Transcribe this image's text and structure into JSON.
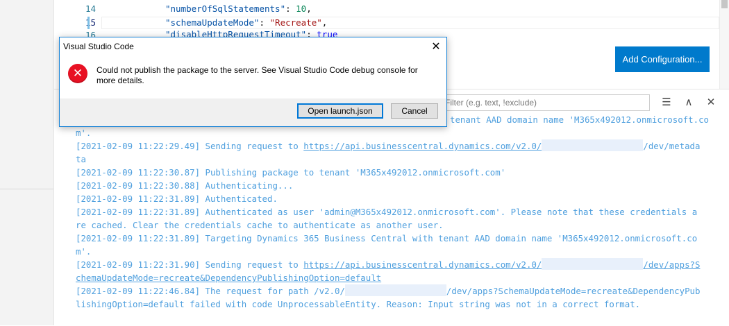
{
  "editor": {
    "lines": [
      {
        "number": "14",
        "key": "\"numberOfSqlStatements\"",
        "sep": ": ",
        "value": "10",
        "trail": ","
      },
      {
        "number": "15",
        "key": "\"schemaUpdateMode\"",
        "sep": ": ",
        "value": "\"Recreate\"",
        "trail": ","
      },
      {
        "number": "16",
        "key": "\"disableHttpRequestTimeout\"",
        "sep": ": ",
        "value": "true",
        "trail": ""
      }
    ]
  },
  "add_configuration_label": "Add Configuration...",
  "output": {
    "filter_placeholder": "Filter (e.g. text, !exclude)",
    "lines": [
      "m'.",
      "[2021-02-09 11:22:29.49] Sending request to ",
      "https://api.businesscentral.dynamics.com/v2.0/",
      "/dev/metada",
      "ta",
      "[2021-02-09 11:22:30.87] Publishing package to tenant 'M365x492012.onmicrosoft.com'",
      "[2021-02-09 11:22:30.88] Authenticating...",
      "[2021-02-09 11:22:31.89] Authenticated.",
      "[2021-02-09 11:22:31.89] Authenticated as user 'admin@M365x492012.onmicrosoft.com'. Please note that these credentials a",
      "re cached. Clear the credentials cache to authenticate as another user.",
      "[2021-02-09 11:22:31.89] Targeting Dynamics 365 Business Central with tenant AAD domain name 'M365x492012.onmicrosoft.co",
      "m'.",
      "[2021-02-09 11:22:31.90] Sending request to ",
      "https://api.businesscentral.dynamics.com/v2.0/",
      "/dev/apps?S",
      "chemaUpdateMode=recreate&DependencyPublishingOption=default",
      "[2021-02-09 11:22:46.84] The request for path /v2.0/",
      "/dev/apps?SchemaUpdateMode=recreate&DependencyPub",
      "lishingOption=default failed with code UnprocessableEntity. Reason: Input string was not in a correct format."
    ],
    "partial_top": "tenant AAD domain name 'M365x492012.onmicrosoft.co"
  },
  "dialog": {
    "title": "Visual Studio Code",
    "close_glyph": "✕",
    "message": "Could not publish the package to the server. See Visual Studio Code debug console for more details.",
    "primary_button": "Open launch.json",
    "cancel_button": "Cancel"
  },
  "icons": {
    "error": "✕",
    "list": "☰",
    "up": "∧",
    "close": "✕"
  }
}
